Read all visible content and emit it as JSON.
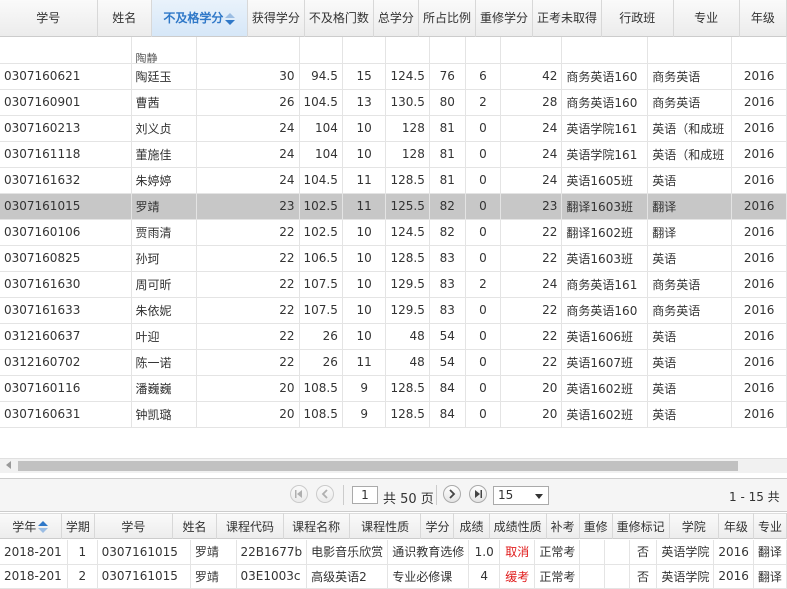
{
  "main_table": {
    "sort_column": "不及格学分",
    "headers": [
      "学号",
      "姓名",
      "不及格学分",
      "获得学分",
      "不及格门数",
      "总学分",
      "所占比例",
      "重修学分",
      "正考未取得",
      "行政班",
      "专业",
      "年级"
    ],
    "partial_row_text": "陶静",
    "rows": [
      {
        "id": "0307160621",
        "name": "陶廷玉",
        "fail": "30",
        "got": "94.5",
        "failcnt": "15",
        "total": "124.5",
        "ratio": "76",
        "retake": "6",
        "unpassed": "42",
        "class": "商务英语160",
        "major": "商务英语",
        "grade": "2016",
        "selected": false
      },
      {
        "id": "0307160901",
        "name": "曹茜",
        "fail": "26",
        "got": "104.5",
        "failcnt": "13",
        "total": "130.5",
        "ratio": "80",
        "retake": "2",
        "unpassed": "28",
        "class": "商务英语160",
        "major": "商务英语",
        "grade": "2016",
        "selected": false
      },
      {
        "id": "0307160213",
        "name": "刘义贞",
        "fail": "24",
        "got": "104",
        "failcnt": "10",
        "total": "128",
        "ratio": "81",
        "retake": "0",
        "unpassed": "24",
        "class": "英语学院161",
        "major": "英语（和成班",
        "grade": "2016",
        "selected": false
      },
      {
        "id": "0307161118",
        "name": "董施佳",
        "fail": "24",
        "got": "104",
        "failcnt": "10",
        "total": "128",
        "ratio": "81",
        "retake": "0",
        "unpassed": "24",
        "class": "英语学院161",
        "major": "英语（和成班",
        "grade": "2016",
        "selected": false
      },
      {
        "id": "0307161632",
        "name": "朱婷婷",
        "fail": "24",
        "got": "104.5",
        "failcnt": "11",
        "total": "128.5",
        "ratio": "81",
        "retake": "0",
        "unpassed": "24",
        "class": "英语1605班",
        "major": "英语",
        "grade": "2016",
        "selected": false
      },
      {
        "id": "0307161015",
        "name": "罗靖",
        "fail": "23",
        "got": "102.5",
        "failcnt": "11",
        "total": "125.5",
        "ratio": "82",
        "retake": "0",
        "unpassed": "23",
        "class": "翻译1603班",
        "major": "翻译",
        "grade": "2016",
        "selected": true
      },
      {
        "id": "0307160106",
        "name": "贾雨清",
        "fail": "22",
        "got": "102.5",
        "failcnt": "10",
        "total": "124.5",
        "ratio": "82",
        "retake": "0",
        "unpassed": "22",
        "class": "翻译1602班",
        "major": "翻译",
        "grade": "2016",
        "selected": false
      },
      {
        "id": "0307160825",
        "name": "孙珂",
        "fail": "22",
        "got": "106.5",
        "failcnt": "10",
        "total": "128.5",
        "ratio": "83",
        "retake": "0",
        "unpassed": "22",
        "class": "英语1603班",
        "major": "英语",
        "grade": "2016",
        "selected": false
      },
      {
        "id": "0307161630",
        "name": "周可昕",
        "fail": "22",
        "got": "107.5",
        "failcnt": "10",
        "total": "129.5",
        "ratio": "83",
        "retake": "2",
        "unpassed": "24",
        "class": "商务英语161",
        "major": "商务英语",
        "grade": "2016",
        "selected": false
      },
      {
        "id": "0307161633",
        "name": "朱依妮",
        "fail": "22",
        "got": "107.5",
        "failcnt": "10",
        "total": "129.5",
        "ratio": "83",
        "retake": "0",
        "unpassed": "22",
        "class": "商务英语160",
        "major": "商务英语",
        "grade": "2016",
        "selected": false
      },
      {
        "id": "0312160637",
        "name": "叶迎",
        "fail": "22",
        "got": "26",
        "failcnt": "10",
        "total": "48",
        "ratio": "54",
        "retake": "0",
        "unpassed": "22",
        "class": "英语1606班",
        "major": "英语",
        "grade": "2016",
        "selected": false
      },
      {
        "id": "0312160702",
        "name": "陈一诺",
        "fail": "22",
        "got": "26",
        "failcnt": "11",
        "total": "48",
        "ratio": "54",
        "retake": "0",
        "unpassed": "22",
        "class": "英语1607班",
        "major": "英语",
        "grade": "2016",
        "selected": false
      },
      {
        "id": "0307160116",
        "name": "潘巍巍",
        "fail": "20",
        "got": "108.5",
        "failcnt": "9",
        "total": "128.5",
        "ratio": "84",
        "retake": "0",
        "unpassed": "20",
        "class": "英语1602班",
        "major": "英语",
        "grade": "2016",
        "selected": false
      },
      {
        "id": "0307160631",
        "name": "钟凯璐",
        "fail": "20",
        "got": "108.5",
        "failcnt": "9",
        "total": "128.5",
        "ratio": "84",
        "retake": "0",
        "unpassed": "20",
        "class": "英语1602班",
        "major": "英语",
        "grade": "2016",
        "selected": false
      }
    ]
  },
  "pager": {
    "current_page": "1",
    "total_label": "共 50 页",
    "page_size": "15",
    "range_info": "1 - 15  共"
  },
  "sub_table": {
    "headers": [
      "学年",
      "学期",
      "学号",
      "姓名",
      "课程代码",
      "课程名称",
      "课程性质",
      "学分",
      "成绩",
      "成绩性质",
      "补考",
      "重修",
      "重修标记",
      "学院",
      "年级",
      "专业"
    ],
    "rows": [
      {
        "year": "2018-201",
        "term": "1",
        "id": "0307161015",
        "name": "罗靖",
        "code": "22B1677b",
        "course": "电影音乐欣赏",
        "nature": "通识教育选修",
        "credit": "1.0",
        "score": "取消",
        "score_type": "正常考",
        "makeup": "",
        "retake": "",
        "retake_flag": "否",
        "college": "英语学院",
        "grade": "2016",
        "major": "翻译"
      },
      {
        "year": "2018-201",
        "term": "2",
        "id": "0307161015",
        "name": "罗靖",
        "code": "03E1003c",
        "course": "高级英语2",
        "nature": "专业必修课",
        "credit": "4",
        "score": "缓考",
        "score_type": "正常考",
        "makeup": "",
        "retake": "",
        "retake_flag": "否",
        "college": "英语学院",
        "grade": "2016",
        "major": "翻译"
      }
    ]
  },
  "colors": {
    "selected_row": "#c7c7c7",
    "sorted_header_text": "#2f78c8",
    "red_score": "#e01b1b"
  }
}
